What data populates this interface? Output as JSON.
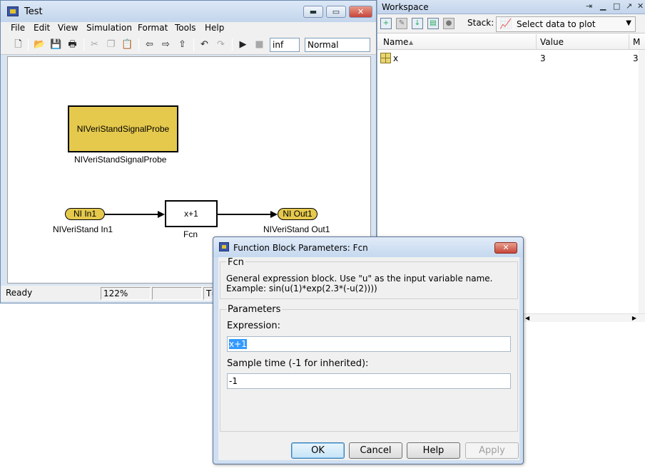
{
  "model_window": {
    "title": "Test",
    "controls": {
      "minimize": "▬",
      "maximize": "▭",
      "close": "✕"
    },
    "menu": [
      "File",
      "Edit",
      "View",
      "Simulation",
      "Format",
      "Tools",
      "Help"
    ],
    "toolbar": {
      "icons": [
        "new-file-icon",
        "open-folder-icon",
        "save-icon",
        "print-icon",
        "cut-icon",
        "copy-icon",
        "paste-icon",
        "back-arrow-icon",
        "forward-arrow-icon",
        "up-arrow-icon",
        "undo-icon",
        "redo-icon",
        "play-icon",
        "stop-icon"
      ],
      "stop_time": "inf",
      "sim_mode": "Normal"
    },
    "blocks": {
      "probe_text": "NIVeriStandSignalProbe",
      "probe_label": "NIVeriStandSignalProbe",
      "in_port_text": "NI In1",
      "in_port_label": "NIVeriStand In1",
      "fcn_text": "x+1",
      "fcn_label": "Fcn",
      "out_port_text": "NI Out1",
      "out_port_label": "NIVeriStand Out1"
    },
    "status": {
      "state": "Ready",
      "zoom": "122%",
      "time_prefix": "T="
    },
    "colors": {
      "block_fill": "#e5c94d",
      "window_frame": "#d8e4f2"
    }
  },
  "workspace": {
    "title": "Workspace",
    "stack_label": "Stack:",
    "plot_select": "Select data to plot",
    "columns": {
      "name": "Name",
      "value": "Value",
      "third": "M"
    },
    "rows": [
      {
        "name": "x",
        "value": "3",
        "third": "3"
      }
    ]
  },
  "dialog": {
    "title": "Function Block Parameters: Fcn",
    "block_name": "Fcn",
    "description_line1": "General expression block. Use \"u\" as the input variable name.",
    "description_line2": "Example: sin(u(1)*exp(2.3*(-u(2))))",
    "params_title": "Parameters",
    "expression_label": "Expression:",
    "expression_value": "x+1",
    "sample_label": "Sample time (-1 for inherited):",
    "sample_value": "-1",
    "buttons": {
      "ok": "OK",
      "cancel": "Cancel",
      "help": "Help",
      "apply": "Apply"
    }
  }
}
